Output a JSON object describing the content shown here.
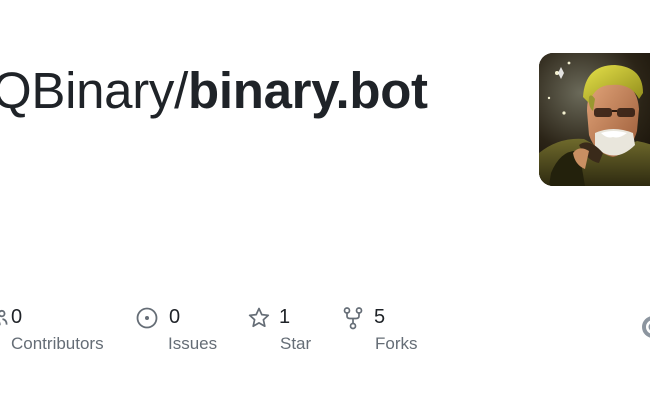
{
  "repo": {
    "owner": "QBinary",
    "separator": "/",
    "name": "binary.bot"
  },
  "avatar": {
    "alt": "owner avatar"
  },
  "stats": [
    {
      "count": "0",
      "label": "Contributors",
      "icon": "people-icon"
    },
    {
      "count": "0",
      "label": "Issues",
      "icon": "issue-opened-icon"
    },
    {
      "count": "1",
      "label": "Star",
      "icon": "star-icon"
    },
    {
      "count": "5",
      "label": "Forks",
      "icon": "repo-forked-icon"
    }
  ],
  "colors": {
    "text_primary": "#1f2328",
    "text_muted": "#656d76",
    "icon": "#656d76"
  }
}
